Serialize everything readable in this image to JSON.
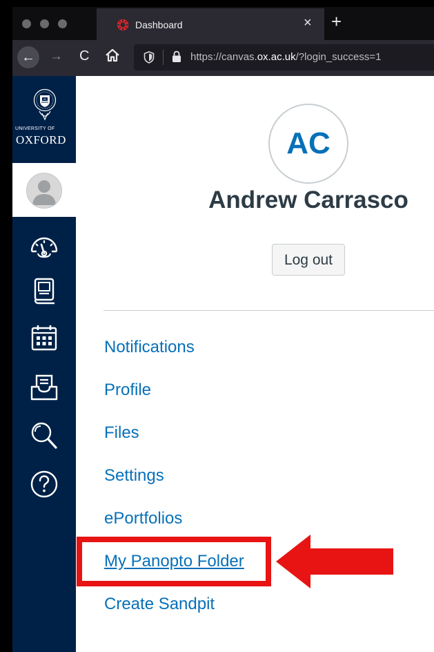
{
  "browser": {
    "tab_title": "Dashboard",
    "tab_close_glyph": "×",
    "new_tab_glyph": "+",
    "nav_glyphs": {
      "back": "←",
      "forward": "→",
      "reload": "C"
    },
    "url_prefix": "https://canvas.",
    "url_domain": "ox.ac.uk",
    "url_suffix": "/?login_success=1"
  },
  "sidebar": {
    "logo_small": "UNIVERSITY OF",
    "logo_main": "OXFORD",
    "items": [
      {
        "icon": "dashboard-icon"
      },
      {
        "icon": "courses-icon"
      },
      {
        "icon": "calendar-icon"
      },
      {
        "icon": "inbox-icon"
      },
      {
        "icon": "search-icon"
      },
      {
        "icon": "help-icon"
      }
    ]
  },
  "account_tray": {
    "initials": "AC",
    "name": "Andrew Carrasco",
    "logout_label": "Log out",
    "links": [
      "Notifications",
      "Profile",
      "Files",
      "Settings",
      "ePortfolios",
      "My Panopto Folder",
      "Create Sandpit"
    ],
    "highlighted_link": "My Panopto Folder"
  },
  "colors": {
    "nav_background": "#002147",
    "link": "#0770b8",
    "name_text": "#2d3b45",
    "annotation_red": "#e81414"
  }
}
